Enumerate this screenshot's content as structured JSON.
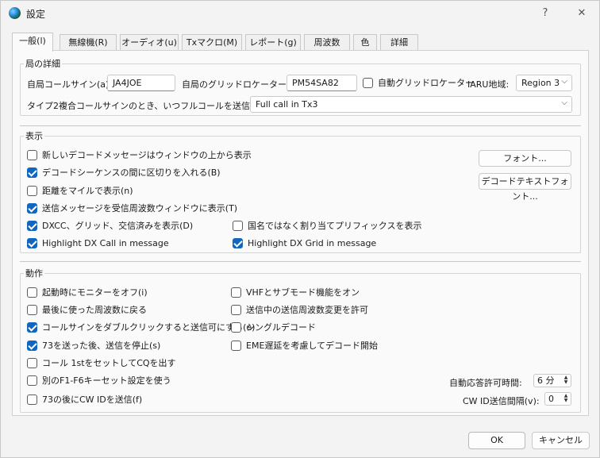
{
  "window": {
    "title": "設定",
    "help": "?",
    "close": "✕"
  },
  "tabs": [
    {
      "label": "一般(l)"
    },
    {
      "label": "無線機(R)"
    },
    {
      "label": "オーディオ(u)"
    },
    {
      "label": "Txマクロ(M)"
    },
    {
      "label": "レポート(g)"
    },
    {
      "label": "周波数"
    },
    {
      "label": "色"
    },
    {
      "label": "詳細"
    }
  ],
  "station": {
    "title": "局の詳細",
    "callsign_label": "自局コールサイン(a):",
    "callsign_value": "JA4JOE",
    "grid_label": "自局のグリッドロケーター(y):",
    "grid_value": "PM54SA82",
    "auto_grid_label": "自動グリッドロケーター",
    "iaru_label": "IARU地域:",
    "iaru_value": "Region 3",
    "type2_label": "タイプ2複合コールサインのとき、いつフルコールを送信するか:",
    "type2_value": "Full call in Tx3"
  },
  "display": {
    "title": "表示",
    "items": [
      {
        "label": "新しいデコードメッセージはウィンドウの上から表示",
        "checked": false
      },
      {
        "label": "デコードシーケンスの間に区切りを入れる(B)",
        "checked": true
      },
      {
        "label": "距離をマイルで表示(n)",
        "checked": false
      },
      {
        "label": "送信メッセージを受信周波数ウィンドウに表示(T)",
        "checked": true
      },
      {
        "label": "DXCC、グリッド、交信済みを表示(D)",
        "checked": true
      },
      {
        "label": "Highlight DX Call in message",
        "checked": true
      },
      {
        "label": "国名ではなく割り当てプリフィックスを表示",
        "checked": false
      },
      {
        "label": "Highlight DX Grid in message",
        "checked": true
      }
    ],
    "font_button": "フォント...",
    "decode_font_button": "デコードテキストフォント..."
  },
  "behavior": {
    "title": "動作",
    "left": [
      {
        "label": "起動時にモニターをオフ(i)",
        "checked": false
      },
      {
        "label": "最後に使った周波数に戻る",
        "checked": false
      },
      {
        "label": "コールサインをダブルクリックすると送信可にする(e)",
        "checked": true
      },
      {
        "label": "73を送った後、送信を停止(s)",
        "checked": true
      },
      {
        "label": "コール 1stをセットしてCQを出す",
        "checked": false
      },
      {
        "label": "別のF1-F6キーセット設定を使う",
        "checked": false
      },
      {
        "label": "73の後にCW IDを送信(f)",
        "checked": false
      }
    ],
    "right": [
      {
        "label": "VHFとサブモード機能をオン",
        "checked": false
      },
      {
        "label": "送信中の送信周波数変更を許可",
        "checked": false
      },
      {
        "label": "シングルデコード",
        "checked": false
      },
      {
        "label": "EME遅延を考慮してデコード開始",
        "checked": false
      }
    ],
    "auto_reply_label": "自動応答許可時間:",
    "auto_reply_value": "6 分",
    "cw_id_label": "CW ID送信間隔(v):",
    "cw_id_value": "0"
  },
  "footer": {
    "ok": "OK",
    "cancel": "キャンセル"
  }
}
